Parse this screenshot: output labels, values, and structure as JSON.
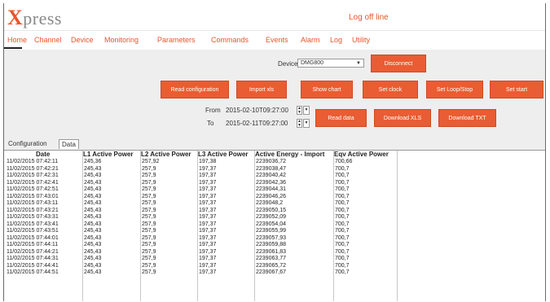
{
  "app": {
    "logo_initial": "X",
    "logo_rest": "press",
    "logoff": "Log off line"
  },
  "nav": [
    "Home",
    "Channel",
    "Device",
    "Monitoring",
    "Parameters",
    "Commands",
    "Events",
    "Alarm",
    "Log",
    "Utility"
  ],
  "device": {
    "label": "Device",
    "value": "DMG800",
    "disconnect": "Disconnect"
  },
  "buttons": {
    "read_config": "Read configuration",
    "import_xls": "Import xls",
    "show_chart": "Show chart",
    "set_clock": "Set clock",
    "set_loop_stop": "Set Loop/Stop",
    "set_start": "Set start",
    "read_data": "Read data",
    "download_xls": "Download XLS",
    "download_txt": "Download TXT"
  },
  "range": {
    "from_label": "From",
    "from_value": "2015-02-10T09:27:00",
    "to_label": "To",
    "to_value": "2015-02-11T09:27:00"
  },
  "tabs": [
    "Configuration",
    "Data"
  ],
  "table": {
    "headers": [
      "Date",
      "L1 Active Power",
      "L2 Active Power",
      "L3 Active Power",
      "Active Energy - Import",
      "Eqv Active Power"
    ],
    "rows": [
      [
        "11/02/2015 07:42:11",
        "245,36",
        "257,92",
        "197,38",
        "2239036,72",
        "700,66"
      ],
      [
        "11/02/2015 07:42:21",
        "245,43",
        "257,9",
        "197,37",
        "2239038,47",
        "700,7"
      ],
      [
        "11/02/2015 07:42:31",
        "245,43",
        "257,9",
        "197,37",
        "2239040,42",
        "700,7"
      ],
      [
        "11/02/2015 07:42:41",
        "245,43",
        "257,9",
        "197,37",
        "2239042,36",
        "700,7"
      ],
      [
        "11/02/2015 07:42:51",
        "245,43",
        "257,9",
        "197,37",
        "2239044,31",
        "700,7"
      ],
      [
        "11/02/2015 07:43:01",
        "245,43",
        "257,9",
        "197,37",
        "2239046,26",
        "700,7"
      ],
      [
        "11/02/2015 07:43:11",
        "245,43",
        "257,9",
        "197,37",
        "2239048,2",
        "700,7"
      ],
      [
        "11/02/2015 07:43:21",
        "245,43",
        "257,9",
        "197,37",
        "2239050,15",
        "700,7"
      ],
      [
        "11/02/2015 07:43:31",
        "245,43",
        "257,9",
        "197,37",
        "2239052,09",
        "700,7"
      ],
      [
        "11/02/2015 07:43:41",
        "245,43",
        "257,9",
        "197,37",
        "2239054,04",
        "700,7"
      ],
      [
        "11/02/2015 07:43:51",
        "245,43",
        "257,9",
        "197,37",
        "2239055,99",
        "700,7"
      ],
      [
        "11/02/2015 07:44:01",
        "245,43",
        "257,9",
        "197,37",
        "2239057,93",
        "700,7"
      ],
      [
        "11/02/2015 07:44:11",
        "245,43",
        "257,9",
        "197,37",
        "2239059,88",
        "700,7"
      ],
      [
        "11/02/2015 07:44:21",
        "245,43",
        "257,9",
        "197,37",
        "2239061,83",
        "700,7"
      ],
      [
        "11/02/2015 07:44:31",
        "245,43",
        "257,9",
        "197,37",
        "2239063,77",
        "700,7"
      ],
      [
        "11/02/2015 07:44:41",
        "245,43",
        "257,9",
        "197,37",
        "2239065,72",
        "700,7"
      ],
      [
        "11/02/2015 07:44:51",
        "245,43",
        "257,9",
        "197,37",
        "2239067,67",
        "700,7"
      ]
    ]
  },
  "colors": {
    "accent": "#ea5c33",
    "panel": "#eeeeee",
    "nav_text": "#e8552b"
  },
  "icons": {
    "select_arrow": "dropdown-arrow-icon",
    "stepper": "spin-stepper-icon",
    "date_dropdown": "date-dropdown-icon"
  }
}
